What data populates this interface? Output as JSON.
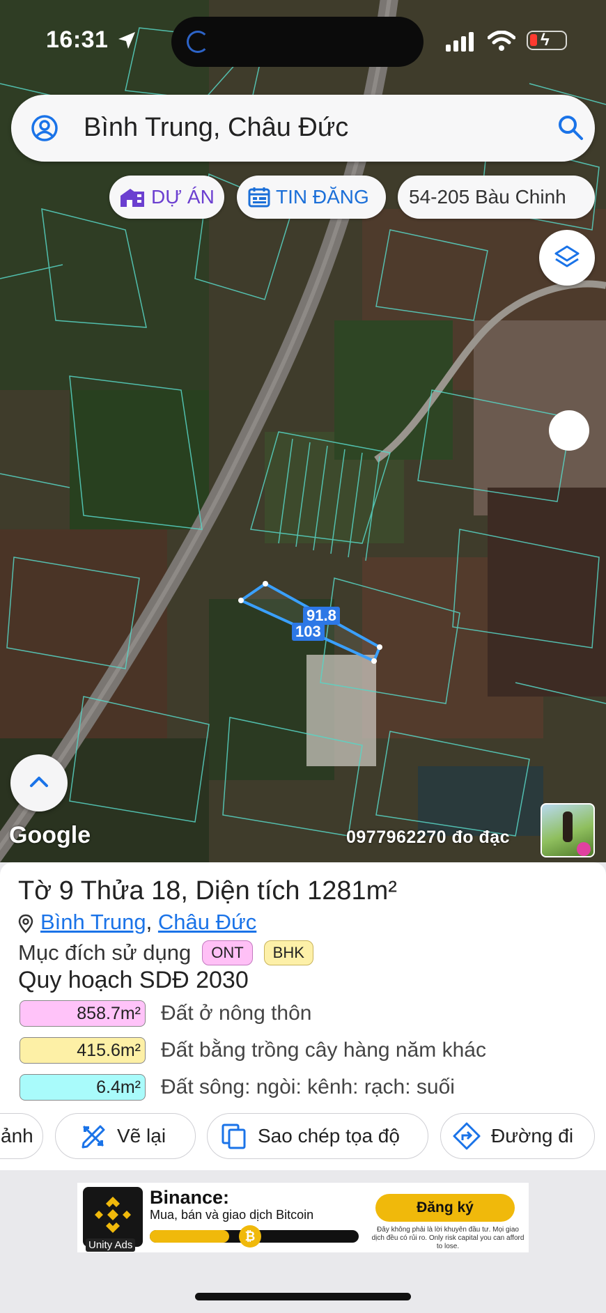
{
  "status_bar": {
    "time": "16:31"
  },
  "search": {
    "query": "Bình Trung, Châu Đức"
  },
  "chips": {
    "du_an": "DỰ ÁN",
    "tin_dang": "TIN ĐĂNG",
    "address": "54-205 Bàu Chinh"
  },
  "map": {
    "measure_1": "91.8",
    "measure_2": "103",
    "attribution": "Google",
    "credit": "0977962270 đo đạc"
  },
  "parcel": {
    "title": "Tờ 9 Thửa 18, Diện tích 1281m²",
    "location_ward": "Bình Trung",
    "location_separator": ",",
    "location_district": "Châu Đức",
    "purpose_label": "Mục đích sử dụng",
    "purpose_tags": [
      "ONT",
      "BHK"
    ],
    "plan_title": "Quy hoạch SDĐ 2030",
    "plan_rows": [
      {
        "area": "858.7m²",
        "label": "Đất ở nông thôn",
        "color": "#ffc3f9"
      },
      {
        "area": "415.6m²",
        "label": "Đất bằng trồng cây hàng năm khác",
        "color": "#fdf0a6"
      },
      {
        "area": "6.4m²",
        "label": "Đất sông: ngòi: kênh: rạch: suối",
        "color": "#a9fbfb"
      }
    ]
  },
  "actions": {
    "partial": "ảnh",
    "redraw": "Vẽ lại",
    "copy_coords": "Sao chép tọa độ",
    "directions": "Đường đi"
  },
  "ad": {
    "brand": "Binance:",
    "subtitle": "Mua, bán và giao dịch Bitcoin",
    "cta": "Đăng ký",
    "disclaimer": "Đây không phải là lời khuyên đầu tư. Mọi giao dịch đều có rủi ro. Only risk capital you can afford to lose.",
    "network": "Unity Ads",
    "progress": 0.38,
    "accent": "#f0b90b"
  }
}
